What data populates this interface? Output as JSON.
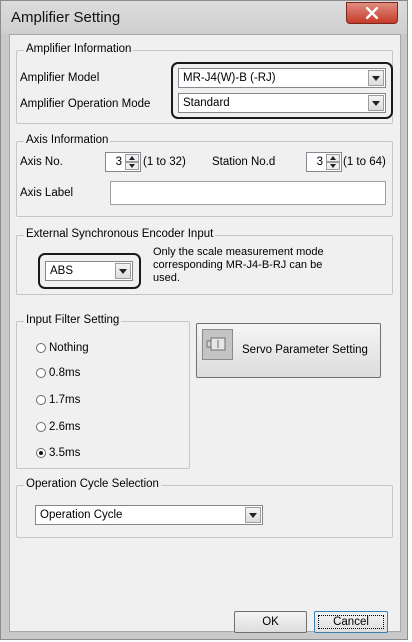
{
  "window": {
    "title": "Amplifier Setting"
  },
  "amplifier_information": {
    "group_label": "Amplifier Information",
    "model_label": "Amplifier Model",
    "model_value": "MR-J4(W)-B (-RJ)",
    "operation_mode_label": "Amplifier Operation Mode",
    "operation_mode_value": "Standard"
  },
  "axis_information": {
    "group_label": "Axis Information",
    "axis_no_label": "Axis No.",
    "axis_no_value": "3",
    "axis_no_range": "(1 to 32)",
    "station_label": "Station No.d",
    "station_value": "3",
    "station_range": "(1 to 64)",
    "axis_label_label": "Axis Label",
    "axis_label_value": ""
  },
  "external_encoder": {
    "group_label": "External Synchronous Encoder Input",
    "value": "ABS",
    "note_line1": "Only the scale measurement mode",
    "note_line2": "corresponding MR-J4-B-RJ can be",
    "note_line3": "used."
  },
  "input_filter": {
    "group_label": "Input Filter Setting",
    "options": [
      "Nothing",
      "0.8ms",
      "1.7ms",
      "2.6ms",
      "3.5ms"
    ],
    "selected": "3.5ms"
  },
  "servo_button": {
    "label": "Servo Parameter Setting"
  },
  "operation_cycle": {
    "group_label": "Operation Cycle Selection",
    "value": "Operation Cycle"
  },
  "footer": {
    "ok": "OK",
    "cancel": "Cancel"
  }
}
